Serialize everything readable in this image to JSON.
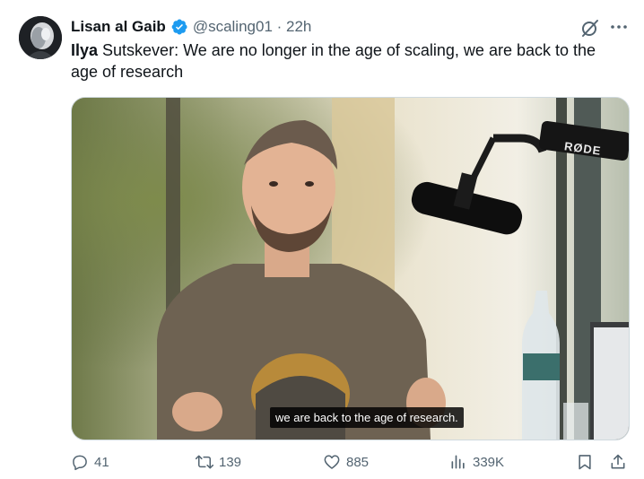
{
  "author": {
    "name": "Lisan al Gaib",
    "handle": "@scaling01 · 22h"
  },
  "tweet": {
    "bold_part": "Ilya",
    "text_rest": " Sutskever: We are no longer in the age of scaling, we are back to the age of research"
  },
  "media": {
    "caption": "we are back to the age of research.",
    "mic_brand": "RØDE"
  },
  "actions": {
    "replies": "41",
    "reposts": "139",
    "likes": "885",
    "views": "339K"
  },
  "colors": {
    "text": "#0f1419",
    "secondary": "#536471",
    "verified": "#1d9bf0"
  },
  "icons": [
    "verified-badge-icon",
    "grok-icon",
    "more-icon",
    "reply-icon",
    "repost-icon",
    "like-icon",
    "views-icon",
    "bookmark-icon",
    "share-icon"
  ]
}
